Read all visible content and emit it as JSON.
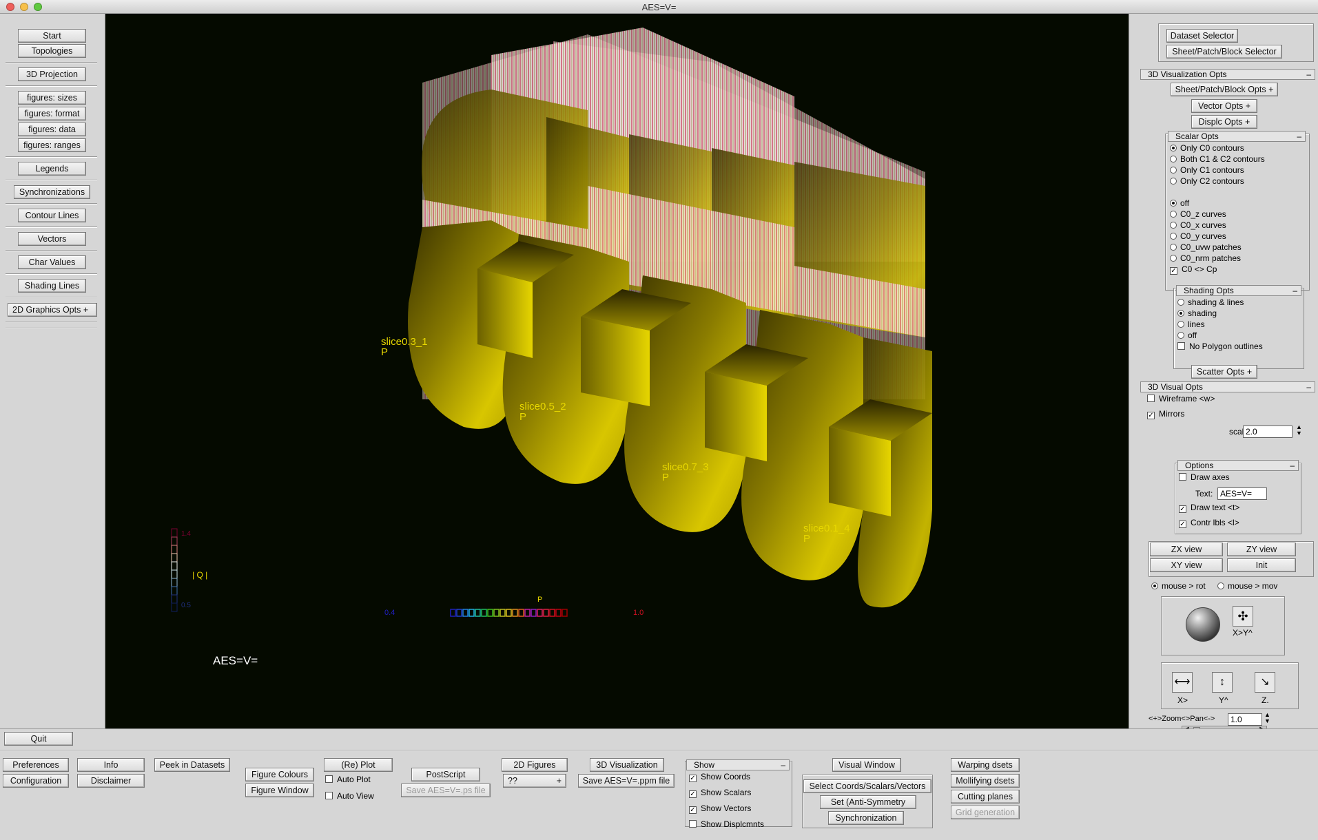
{
  "window": {
    "title": "AES=V="
  },
  "left": {
    "start": "Start",
    "topologies": "Topologies",
    "projection": "3D Projection",
    "fig_sizes": "figures: sizes",
    "fig_format": "figures: format",
    "fig_data": "figures: data",
    "fig_ranges": "figures: ranges",
    "legends": "Legends",
    "synchronizations": "Synchronizations",
    "contour_lines": "Contour Lines",
    "vectors": "Vectors",
    "char_values": "Char Values",
    "shading_lines": "Shading Lines",
    "graphics_2d": "2D Graphics Opts +"
  },
  "canvas": {
    "slice_labels": [
      "slice0.3_1",
      "slice0.5_2",
      "slice0.7_3",
      "slice0.1_4"
    ],
    "p_label": "P",
    "scale_q": {
      "label": "Q",
      "max": "1.4",
      "min": "0.5"
    },
    "scale_p": {
      "label": "P",
      "min": "0.4",
      "max": "1.0"
    },
    "text": "AES=V="
  },
  "right": {
    "dataset_selector": "Dataset Selector",
    "spb_selector": "Sheet/Patch/Block Selector",
    "vis_opts": "3D Visualization Opts",
    "spb_opts": "Sheet/Patch/Block Opts +",
    "vector_opts": "Vector  Opts +",
    "displc_opts": "Displc  Opts +",
    "scalar_opts": "Scalar  Opts",
    "scalar_items": [
      "Only C0 contours",
      "Both C1 &  C2 contours",
      "Only C1 contours",
      "Only C2 contours"
    ],
    "curve_items": [
      "off",
      "C0_z    curves",
      "C0_x    curves",
      "C0_y    curves",
      "C0_uvw patches",
      "C0_nrm patches"
    ],
    "c0cp": "C0 <> Cp",
    "shading_opts": "Shading  Opts",
    "shading_items": [
      "shading & lines",
      "shading",
      "lines",
      "off"
    ],
    "no_polygon": "No Polygon outlines",
    "scatter_opts": "Scatter Opts +",
    "visual_opts": "3D Visual Opts",
    "wireframe": "Wireframe <w>",
    "mirrors": "Mirrors",
    "scales_label": "scales",
    "scales_value": "2.0",
    "options": "Options",
    "draw_axes": "Draw axes",
    "text_label": "Text:",
    "text_value": "AES=V=",
    "draw_text": "Draw  text <t>",
    "contr_lbls": "Contr lbls <l>",
    "zx_view": "ZX view",
    "zy_view": "ZY view",
    "xy_view": "XY view",
    "init": "Init",
    "mouse_rot": "mouse > rot",
    "mouse_mov": "mouse > mov",
    "xy_label": "X>Y^",
    "x_label": "X>",
    "y_label": "Y^",
    "z_label": "Z.",
    "zoom_label": "<+>Zoom<>Pan<->",
    "zoom_value": "1.0"
  },
  "bottom": {
    "quit": "Quit",
    "preferences": "Preferences",
    "configuration": "Configuration",
    "info": "Info",
    "disclaimer": "Disclaimer",
    "peek": "Peek in Datasets",
    "fig_colours": "Figure Colours",
    "fig_window": "Figure Window",
    "replot": "(Re) Plot",
    "auto_plot": "Auto Plot",
    "auto_view": "Auto View",
    "postscript": "PostScript",
    "save_ps": "Save AES=V=.ps file",
    "figures_2d": "2D Figures",
    "figures_value": "??",
    "vis_3d": "3D Visualization",
    "save_ppm": "Save AES=V=.ppm file",
    "show": "Show",
    "show_items": [
      "Show Coords",
      "Show Scalars",
      "Show Vectors",
      "Show Displcmnts"
    ],
    "visual_window": "Visual Window",
    "select_csv": "Select Coords/Scalars/Vectors",
    "set_symmetry": "Set    (Anti-Symmetry",
    "synchronization": "Synchronization",
    "warping": "Warping    dsets",
    "mollifying": "Mollifying dsets",
    "cutting": "Cutting planes",
    "grid_gen": "Grid generation"
  },
  "colors": {
    "canvas_bg": "#050a00",
    "shell": "#c8b400",
    "label_yellow": "#e8d800",
    "mesh_white": "#fff2f2",
    "mesh_red": "#d0103a"
  }
}
